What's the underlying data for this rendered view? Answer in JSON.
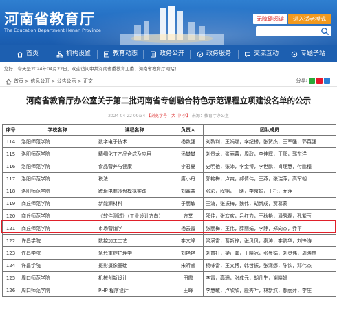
{
  "header": {
    "logo_cn": "河南省教育厅",
    "logo_en": "The Education Department Henan Province",
    "accessible_label": "无障碍阅读",
    "elderly_label": "进入适老模式",
    "search_placeholder": "",
    "colors": {
      "header_blue": "#1f67bd",
      "accent_orange": "#f29a1e",
      "highlight_red": "#e0202a"
    }
  },
  "nav": {
    "items": [
      {
        "label": "首页",
        "icon": "home-icon"
      },
      {
        "label": "机构设置",
        "icon": "org-icon"
      },
      {
        "label": "教育动态",
        "icon": "news-icon"
      },
      {
        "label": "政务公开",
        "icon": "document-icon"
      },
      {
        "label": "政务服务",
        "icon": "service-icon"
      },
      {
        "label": "交流互动",
        "icon": "interaction-icon"
      },
      {
        "label": "专题子站",
        "icon": "topic-icon"
      }
    ]
  },
  "welcome": "您好，今天是2024年04月22日，欢迎访问中共河南省委教育工委、河南省教育厅网站！",
  "breadcrumb": {
    "text": "首页 > 信息公开 > 公告公示 > 正文",
    "share_label": "分享:"
  },
  "article": {
    "title": "河南省教育厅办公室关于第二批河南省专创融合特色示范课程立项建设名单的公示",
    "meta_date": "2024-04-22 09:34",
    "meta_font": "【浏览字号：大 中 小】",
    "meta_source": "来源：教育厅办公室"
  },
  "table": {
    "headers": [
      "序号",
      "学校名称",
      "课程名称",
      "负责人",
      "团队成员"
    ],
    "rows": [
      [
        "114",
        "洛阳师范学院",
        "数字电子技术",
        "杨数强",
        "刘黎利，王娟娜，李纪桥，张贺杰，王军强，郭英强"
      ],
      [
        "115",
        "洛阳师范学院",
        "精细化工产品合成及应用",
        "汤攀攀",
        "刘贵龙，张丽蕾，周政，李佳辉，王邢，郭东洋"
      ],
      [
        "116",
        "洛阳师范学院",
        "食品营养与健康",
        "李君夏",
        "史明艳，张沛，李金博，李世鹏，肖理慧，付鹏程"
      ],
      [
        "117",
        "洛阳师范学院",
        "税法",
        "庸小丹",
        "郭艳梅，卢爽，郝倩伟，王燕，张瑞萍，高军朝"
      ],
      [
        "118",
        "洛阳师范学院",
        "跨境电商沙盘模拟实践",
        "刘鑫益",
        "张彩，程锦，王晓，李京娟，王托，乔萍"
      ],
      [
        "119",
        "商丘师范学院",
        "新能源材料",
        "于丽敏",
        "王涛，张振梅，魏伟，胡新成，贾慕蒙"
      ],
      [
        "120",
        "商丘师范学院",
        "《软件测试》（工业设计方向）",
        "方堂",
        "邵佳，张欢欢，吕红力，王秋艳，潘秀磊，孔繁玉"
      ],
      [
        "121",
        "商丘师范学院",
        "市场营销学",
        "杨云霞",
        "张丽梅，王伟，薛丽娟，李静，郑向杰，乔平"
      ],
      [
        "122",
        "许昌学院",
        "数控加工工艺",
        "李文峰",
        "梁满雷，葛新锋，张贝贝，秦涛，李鹏华，刘锋涛"
      ],
      [
        "123",
        "许昌学院",
        "急危重症护理学",
        "刘艳艳",
        "刘普打，梁正瀚，王晓冰，张曼娟，刘灵伟，周晓林"
      ],
      [
        "124",
        "许昌学院",
        "摄影摄像基础",
        "宋昕睿",
        "杨咏雷，王文博，韩哲振，张潇娜，陈钦，邓伟杰"
      ],
      [
        "125",
        "周口师范学院",
        "机械创新设计",
        "田霞",
        "李雷，高珊，张成元，胡凡生，谢晓娟"
      ],
      [
        "126",
        "周口师范学院",
        "PHP 程序设计",
        "王峰",
        "李慧敏，卢欣欣，殿秀叶，林新然，郝丽萍，李庄"
      ]
    ],
    "highlighted_row_index": 5
  }
}
